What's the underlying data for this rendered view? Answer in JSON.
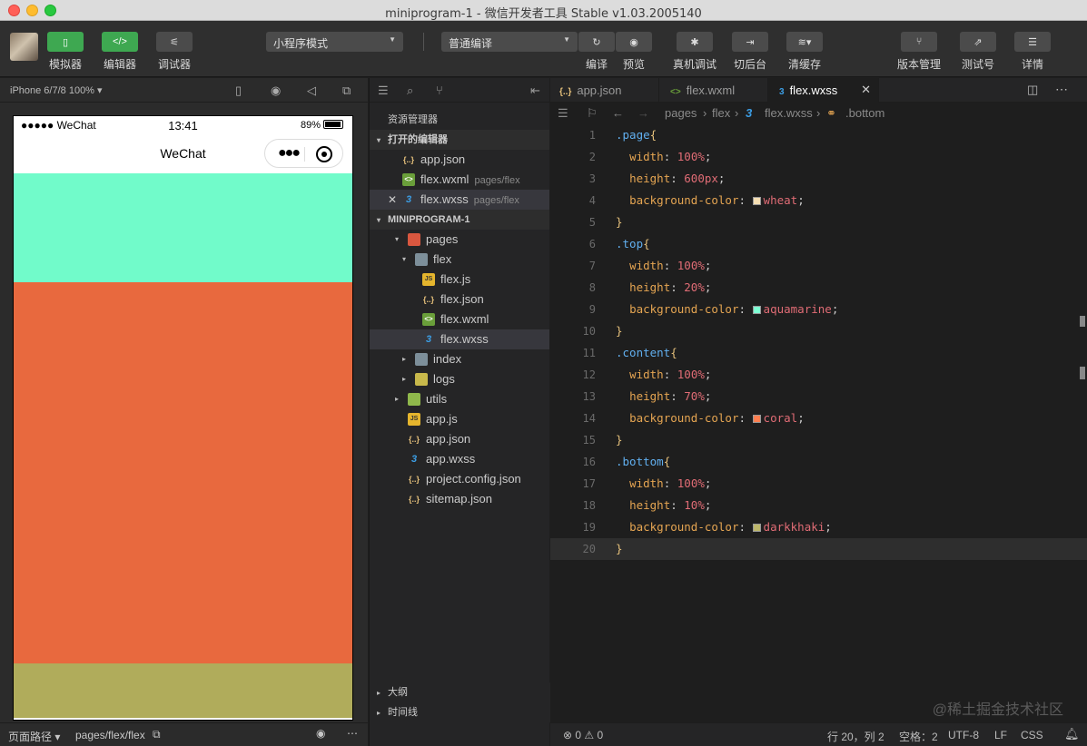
{
  "window": {
    "title": "miniprogram-1 - 微信开发者工具 Stable v1.03.2005140"
  },
  "toolbar": {
    "simulator": "模拟器",
    "editor": "编辑器",
    "debugger": "调试器",
    "mode_select": "小程序模式",
    "compile_select": "普通编译",
    "compile": "编译",
    "preview": "预览",
    "real_debug": "真机调试",
    "background": "切后台",
    "clear_cache": "清缓存",
    "version": "版本管理",
    "test_account": "测试号",
    "details": "详情"
  },
  "simulator": {
    "device": "iPhone 6/7/8 100%",
    "status_left": "●●●●● WeChat",
    "status_time": "13:41",
    "status_battery": "89%",
    "nav_title": "WeChat",
    "blocks": [
      {
        "name": "top",
        "color": "#71fbca",
        "height_pct": 20
      },
      {
        "name": "content",
        "color": "#e8693e",
        "height_pct": 70
      },
      {
        "name": "bottom",
        "color": "#b0ac5b",
        "height_pct": 10
      }
    ],
    "footer_path_label": "页面路径",
    "footer_path": "pages/flex/flex"
  },
  "explorer": {
    "header": "资源管理器",
    "open_editors_label": "打开的编辑器",
    "open_editors": [
      {
        "name": "app.json",
        "hint": "",
        "icon": "json"
      },
      {
        "name": "flex.wxml",
        "hint": "pages/flex",
        "icon": "wxml"
      },
      {
        "name": "flex.wxss",
        "hint": "pages/flex",
        "icon": "wxss"
      }
    ],
    "project_label": "MINIPROGRAM-1",
    "tree": [
      {
        "name": "pages",
        "icon": "folder-red",
        "depth": 1,
        "arrow": "▾"
      },
      {
        "name": "flex",
        "icon": "folder",
        "depth": 2,
        "arrow": "▾"
      },
      {
        "name": "flex.js",
        "icon": "js",
        "depth": 3,
        "arrow": ""
      },
      {
        "name": "flex.json",
        "icon": "json",
        "depth": 3,
        "arrow": ""
      },
      {
        "name": "flex.wxml",
        "icon": "wxml",
        "depth": 3,
        "arrow": ""
      },
      {
        "name": "flex.wxss",
        "icon": "wxss",
        "depth": 3,
        "arrow": ""
      },
      {
        "name": "index",
        "icon": "folder",
        "depth": 2,
        "arrow": "▸"
      },
      {
        "name": "logs",
        "icon": "folder-yellow",
        "depth": 2,
        "arrow": "▸"
      },
      {
        "name": "utils",
        "icon": "folder-green",
        "depth": 1,
        "arrow": "▸"
      },
      {
        "name": "app.js",
        "icon": "js",
        "depth": 1,
        "arrow": ""
      },
      {
        "name": "app.json",
        "icon": "json",
        "depth": 1,
        "arrow": ""
      },
      {
        "name": "app.wxss",
        "icon": "wxss",
        "depth": 1,
        "arrow": ""
      },
      {
        "name": "project.config.json",
        "icon": "json",
        "depth": 1,
        "arrow": ""
      },
      {
        "name": "sitemap.json",
        "icon": "json",
        "depth": 1,
        "arrow": ""
      }
    ],
    "outline": "大纲",
    "timeline": "时间线"
  },
  "editor": {
    "tabs": [
      {
        "name": "app.json",
        "icon": "{..}"
      },
      {
        "name": "flex.wxml",
        "icon": "<>"
      },
      {
        "name": "flex.wxss",
        "icon": "3"
      }
    ],
    "breadcrumb": [
      "pages",
      "flex",
      "flex.wxss",
      ".bottom"
    ],
    "lines": [
      {
        "n": "1",
        "t": ".page{"
      },
      {
        "n": "2",
        "t": "  width: 100%;"
      },
      {
        "n": "3",
        "t": "  height: 600px;"
      },
      {
        "n": "4",
        "t": "  background-color: wheat;",
        "swatch": "#f5deb3"
      },
      {
        "n": "5",
        "t": "}"
      },
      {
        "n": "6",
        "t": ".top{"
      },
      {
        "n": "7",
        "t": "  width: 100%;"
      },
      {
        "n": "8",
        "t": "  height: 20%;"
      },
      {
        "n": "9",
        "t": "  background-color: aquamarine;",
        "swatch": "#7fffd4"
      },
      {
        "n": "10",
        "t": "}"
      },
      {
        "n": "11",
        "t": ".content{"
      },
      {
        "n": "12",
        "t": "  width: 100%;"
      },
      {
        "n": "13",
        "t": "  height: 70%;"
      },
      {
        "n": "14",
        "t": "  background-color: coral;",
        "swatch": "#ff7f50"
      },
      {
        "n": "15",
        "t": "}"
      },
      {
        "n": "16",
        "t": ".bottom{"
      },
      {
        "n": "17",
        "t": "  width: 100%;"
      },
      {
        "n": "18",
        "t": "  height: 10%;"
      },
      {
        "n": "19",
        "t": "  background-color: darkkhaki;",
        "swatch": "#bdb76b"
      },
      {
        "n": "20",
        "t": "}"
      }
    ]
  },
  "status": {
    "errors": "⊗ 0 ⚠ 0",
    "position": "行 20，列 2",
    "spaces": "空格：2",
    "encoding": "UTF-8",
    "eol": "LF",
    "language": "CSS"
  },
  "watermark": "@稀土掘金技术社区"
}
